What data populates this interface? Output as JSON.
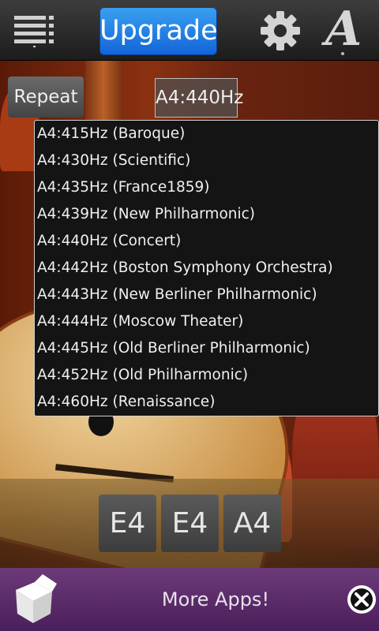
{
  "toolbar": {
    "upgrade_label": "Upgrade",
    "menu_icon": "menu-list-icon",
    "settings_icon": "gear-icon",
    "font_icon_label": "A"
  },
  "controls": {
    "repeat_label": "Repeat",
    "frequency_value": "A4:440Hz"
  },
  "dropdown": {
    "options": [
      "A4:415Hz (Baroque)",
      "A4:430Hz (Scientific)",
      "A4:435Hz (France1859)",
      "A4:439Hz (New Philharmonic)",
      "A4:440Hz (Concert)",
      "A4:442Hz (Boston Symphony Orchestra)",
      "A4:443Hz (New Berliner Philharmonic)",
      "A4:444Hz (Moscow Theater)",
      "A4:445Hz (Old Berliner Philharmonic)",
      "A4:452Hz (Old Philharmonic)",
      "A4:460Hz (Renaissance)"
    ]
  },
  "strings": {
    "notes": [
      "E4",
      "E4",
      "A4"
    ]
  },
  "ad": {
    "label": "More Apps!",
    "icon": "app-box-icon",
    "close_icon": "close-icon"
  },
  "colors": {
    "upgrade_blue": "#1a7be6",
    "ad_purple": "#5a2a6a",
    "dropdown_bg": "#141414"
  }
}
